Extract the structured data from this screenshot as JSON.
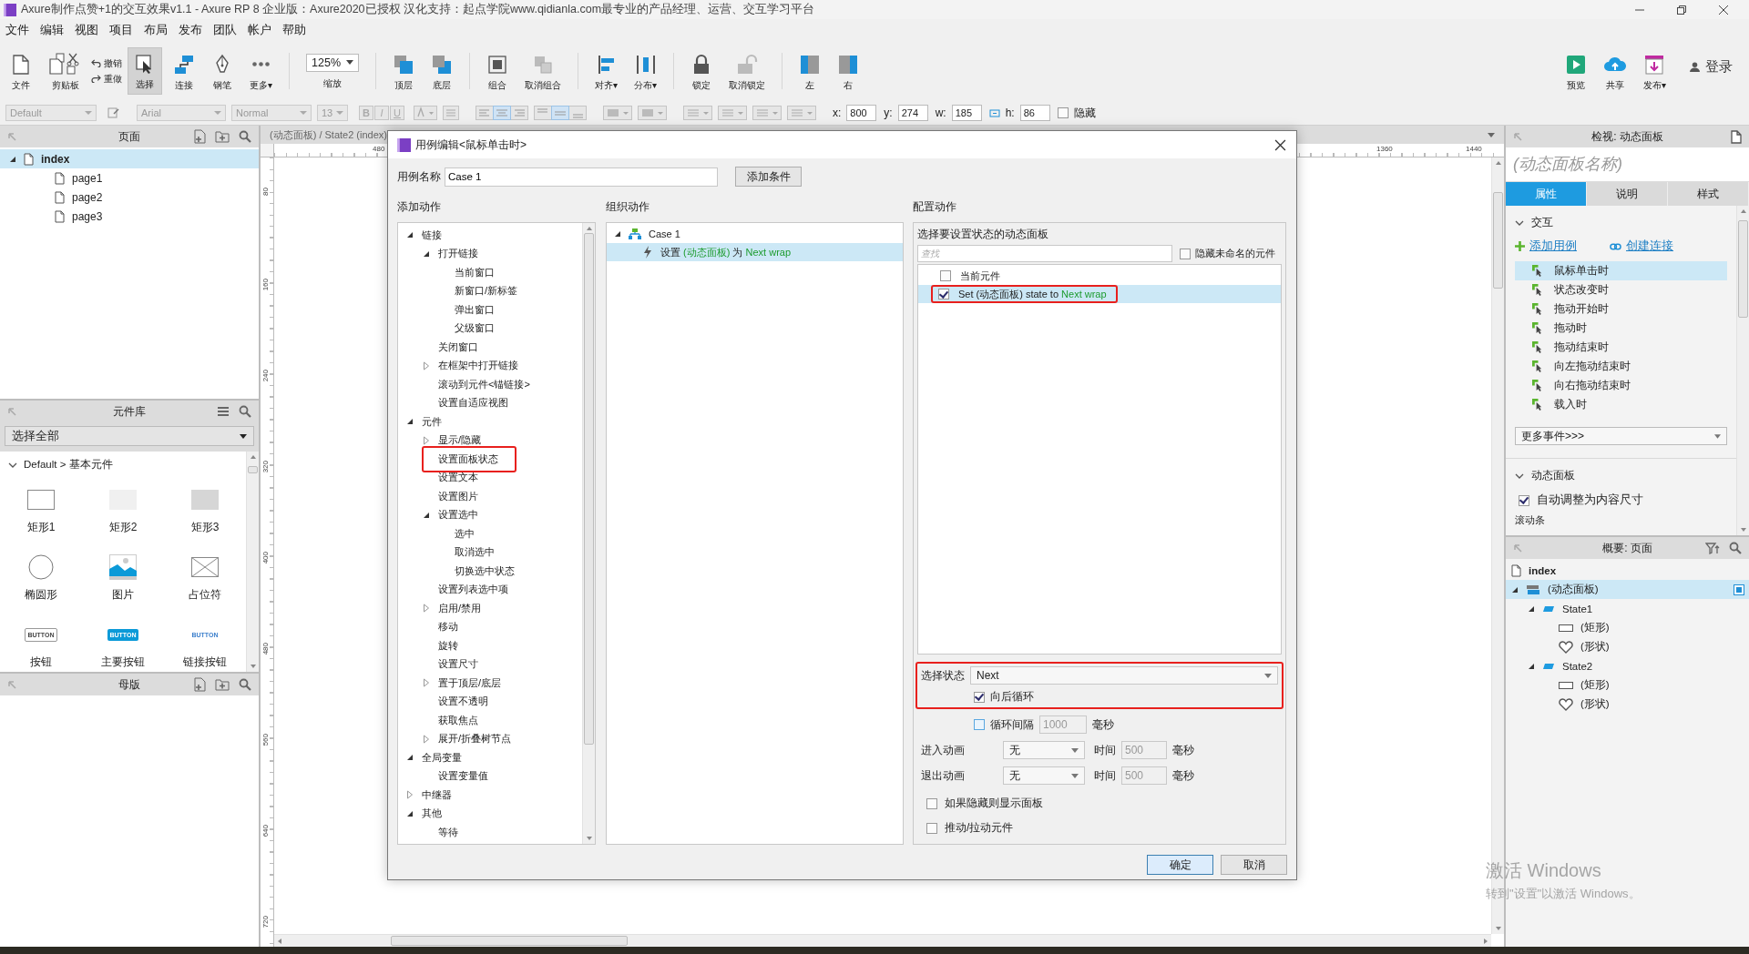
{
  "window": {
    "title": "Axure制作点赞+1的交互效果v1.1 - Axure RP 8 企业版：Axure2020已授权 汉化支持：起点学院www.qidianla.com最专业的产品经理、运营、交互学习平台"
  },
  "menu": [
    "文件",
    "编辑",
    "视图",
    "项目",
    "布局",
    "发布",
    "团队",
    "帐户",
    "帮助"
  ],
  "toolbar": {
    "tools": [
      {
        "kind": "file",
        "label": "文件"
      },
      {
        "kind": "clipboard",
        "label": "剪贴板"
      },
      {
        "kind": "history",
        "undo": "撤销",
        "redo": "重做"
      },
      {
        "kind": "select",
        "label": "选择",
        "selected": true
      },
      {
        "kind": "connect",
        "label": "连接",
        "selected": false
      },
      {
        "kind": "pen",
        "label": "钢笔",
        "selected": false
      },
      {
        "kind": "more",
        "label": "更多▾"
      },
      {
        "kind": "zoom",
        "value": "125%",
        "label": "缩放"
      },
      {
        "kind": "front",
        "label": "顶层"
      },
      {
        "kind": "back",
        "label": "底层"
      },
      {
        "kind": "group",
        "label": "组合"
      },
      {
        "kind": "ungroup",
        "label": "取消组合"
      },
      {
        "kind": "align",
        "label": "对齐▾"
      },
      {
        "kind": "distribute",
        "label": "分布▾"
      },
      {
        "kind": "lock",
        "label": "锁定"
      },
      {
        "kind": "unlock",
        "label": "取消锁定"
      },
      {
        "kind": "left",
        "label": "左"
      },
      {
        "kind": "right",
        "label": "右"
      }
    ],
    "actions": [
      {
        "kind": "preview",
        "label": "预览"
      },
      {
        "kind": "share",
        "label": "共享"
      },
      {
        "kind": "publish",
        "label": "发布▾"
      }
    ],
    "login": "登录"
  },
  "format_bar": {
    "style": "Default",
    "font": "Arial",
    "weight": "Normal",
    "size": "13",
    "styles": [
      "B",
      "I",
      "U"
    ],
    "position": [
      {
        "label": "x:",
        "value": "800"
      },
      {
        "label": "y:",
        "value": "274"
      },
      {
        "label": "w:",
        "value": "185"
      },
      {
        "label": "h:",
        "value": "86"
      }
    ],
    "hidden": {
      "label": "隐藏",
      "checked": false
    }
  },
  "pages": {
    "title": "页面",
    "tree": [
      {
        "label": "index",
        "selected": true,
        "expanded": true,
        "children": [
          {
            "label": "page1",
            "selected": false
          },
          {
            "label": "page2",
            "selected": false
          },
          {
            "label": "page3",
            "selected": false
          }
        ]
      }
    ]
  },
  "library": {
    "title": "元件库",
    "filter": "选择全部",
    "group": "Default > 基本元件",
    "widgets": [
      {
        "kind": "rect-outline",
        "label": "矩形1"
      },
      {
        "kind": "rect-light",
        "label": "矩形2"
      },
      {
        "kind": "rect-dark",
        "label": "矩形3"
      },
      {
        "kind": "ellipse",
        "label": "椭圆形"
      },
      {
        "kind": "image",
        "label": "图片"
      },
      {
        "kind": "placeholder",
        "label": "占位符"
      },
      {
        "kind": "button",
        "label": "按钮",
        "text": "BUTTON"
      },
      {
        "kind": "primary-button",
        "label": "主要按钮",
        "text": "BUTTON"
      },
      {
        "kind": "link-button",
        "label": "链接按钮",
        "text": "BUTTON"
      }
    ]
  },
  "masters": {
    "title": "母版"
  },
  "canvas": {
    "tab": "(动态面板) / State2 (index)",
    "top_ruler": [
      "480",
      "1360",
      "1440"
    ],
    "left_ruler": [
      "80",
      "160",
      "240",
      "320",
      "400",
      "480",
      "560",
      "640",
      "720"
    ]
  },
  "dialog": {
    "title": "用例编辑<鼠标单击时>",
    "case_name": {
      "label": "用例名称",
      "value": "Case 1"
    },
    "add_condition": "添加条件",
    "add_actions": {
      "title": "添加动作",
      "tree": [
        {
          "label": "链接",
          "expanded": true,
          "children": [
            {
              "label": "打开链接",
              "expanded": true,
              "children": [
                {
                  "label": "当前窗口"
                },
                {
                  "label": "新窗口/新标签"
                },
                {
                  "label": "弹出窗口"
                },
                {
                  "label": "父级窗口"
                }
              ]
            },
            {
              "label": "关闭窗口"
            },
            {
              "label": "在框架中打开链接",
              "expanded": false
            },
            {
              "label": "滚动到元件<锚链接>"
            },
            {
              "label": "设置自适应视图"
            }
          ]
        },
        {
          "label": "元件",
          "expanded": true,
          "children": [
            {
              "label": "显示/隐藏",
              "expanded": false
            },
            {
              "label": "设置面板状态",
              "annotated": true
            },
            {
              "label": "设置文本"
            },
            {
              "label": "设置图片"
            },
            {
              "label": "设置选中",
              "expanded": true,
              "children": [
                {
                  "label": "选中"
                },
                {
                  "label": "取消选中"
                },
                {
                  "label": "切换选中状态"
                }
              ]
            },
            {
              "label": "设置列表选中项"
            },
            {
              "label": "启用/禁用",
              "expanded": false
            },
            {
              "label": "移动"
            },
            {
              "label": "旋转"
            },
            {
              "label": "设置尺寸"
            },
            {
              "label": "置于顶层/底层",
              "expanded": false
            },
            {
              "label": "设置不透明"
            },
            {
              "label": "获取焦点"
            },
            {
              "label": "展开/折叠树节点",
              "expanded": false
            }
          ]
        },
        {
          "label": "全局变量",
          "expanded": true,
          "children": [
            {
              "label": "设置变量值"
            }
          ]
        },
        {
          "label": "中继器",
          "expanded": false
        },
        {
          "label": "其他",
          "expanded": true,
          "children": [
            {
              "label": "等待"
            }
          ]
        }
      ]
    },
    "organize": {
      "title": "组织动作",
      "case": {
        "label": "Case 1",
        "expanded": true,
        "actions": [
          {
            "verb": "设置",
            "target": "(动态面板)",
            "connector": "为",
            "value": "Next wrap",
            "selected": true
          }
        ]
      }
    },
    "configure": {
      "title": "配置动作",
      "panel_label": "选择要设置状态的动态面板",
      "search_placeholder": "查找",
      "hide_unnamed": {
        "label": "隐藏未命名的元件",
        "checked": false
      },
      "targets": [
        {
          "label": "当前元件",
          "checked": false,
          "selected": false,
          "annotated": false
        },
        {
          "label": "Set (动态面板) state to",
          "value": "Next wrap",
          "checked": true,
          "selected": true,
          "annotated": true
        }
      ],
      "state": {
        "annotated": true,
        "label": "选择状态",
        "value": "Next",
        "wrap": {
          "label": "向后循环",
          "checked": true
        }
      },
      "interval": {
        "label": "循环间隔",
        "checked": false,
        "value": "1000",
        "unit": "毫秒"
      },
      "animations": [
        {
          "label": "进入动画",
          "value": "无",
          "time_label": "时间",
          "time": "500",
          "unit": "毫秒"
        },
        {
          "label": "退出动画",
          "value": "无",
          "time_label": "时间",
          "time": "500",
          "unit": "毫秒"
        }
      ],
      "options": [
        {
          "label": "如果隐藏则显示面板",
          "checked": false
        },
        {
          "label": "推动/拉动元件",
          "checked": false
        }
      ]
    },
    "buttons": [
      {
        "kind": "primary",
        "label": "确定"
      },
      {
        "kind": "default",
        "label": "取消"
      }
    ]
  },
  "inspector": {
    "title": "检视: 动态面板",
    "name_placeholder": "(动态面板名称)",
    "tabs": [
      {
        "label": "属性",
        "selected": true
      },
      {
        "label": "说明",
        "selected": false
      },
      {
        "label": "样式",
        "selected": false
      }
    ],
    "interaction": {
      "title": "交互",
      "expanded": true,
      "add_case": "添加用例",
      "create_link": "创建连接",
      "events": [
        {
          "label": "鼠标单击时",
          "selected": true
        },
        {
          "label": "状态改变时",
          "selected": false
        },
        {
          "label": "拖动开始时",
          "selected": false
        },
        {
          "label": "拖动时",
          "selected": false
        },
        {
          "label": "拖动结束时",
          "selected": false
        },
        {
          "label": "向左拖动结束时",
          "selected": false
        },
        {
          "label": "向右拖动结束时",
          "selected": false
        },
        {
          "label": "载入时",
          "selected": false
        }
      ],
      "more_events": "更多事件>>>"
    },
    "dynamic_panel": {
      "title": "动态面板",
      "expanded": true,
      "auto_fit": {
        "label": "自动调整为内容尺寸",
        "checked": true
      }
    },
    "next_section": "滚动条"
  },
  "outline": {
    "title": "概要: 页面",
    "tree": [
      {
        "kind": "page",
        "label": "index",
        "selected": false
      },
      {
        "kind": "panel",
        "label": "(动态面板)",
        "selected": true,
        "expanded": true,
        "children": [
          {
            "kind": "state",
            "label": "State1",
            "selected": false,
            "expanded": true,
            "children": [
              {
                "kind": "rect",
                "label": "(矩形)",
                "selected": false
              },
              {
                "kind": "shape",
                "label": "(形状)",
                "selected": false
              }
            ]
          },
          {
            "kind": "state",
            "label": "State2",
            "selected": false,
            "expanded": true,
            "children": [
              {
                "kind": "rect",
                "label": "(矩形)",
                "selected": false
              },
              {
                "kind": "shape",
                "label": "(形状)",
                "selected": false
              }
            ]
          }
        ]
      }
    ]
  },
  "activation": {
    "title": "激活 Windows",
    "hint": "转到\"设置\"以激活 Windows。"
  }
}
